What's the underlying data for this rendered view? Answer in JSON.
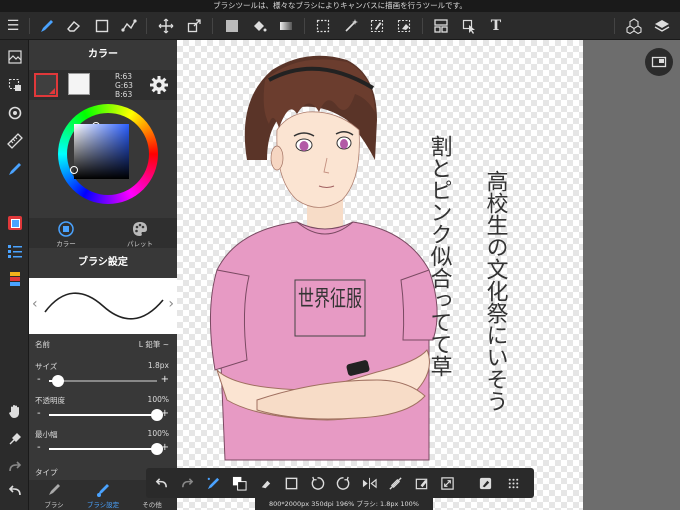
{
  "infobar": {
    "text": "ブラシツールは、様々なブラシによりキャンバスに描画を行うツールです。"
  },
  "color_panel": {
    "title": "カラー",
    "rgb": [
      "R:63",
      "G:63",
      "B:63"
    ],
    "tabs": [
      {
        "label": "カラー"
      },
      {
        "label": "パレット"
      }
    ]
  },
  "brush_panel": {
    "title": "ブラシ設定",
    "name_label": "名前",
    "name_value": "L 鉛筆 ~",
    "params": [
      {
        "label": "サイズ",
        "value": "1.8px",
        "level": 0.08
      },
      {
        "label": "不透明度",
        "value": "100%",
        "level": 1.0
      },
      {
        "label": "最小幅",
        "value": "100%",
        "level": 1.0
      }
    ],
    "type_label": "タイプ"
  },
  "bottom_tabs": [
    {
      "label": "ブラシ"
    },
    {
      "label": "ブラシ設定"
    },
    {
      "label": "その他"
    }
  ],
  "status": {
    "text": "800*2000px 350dpi 196% ブラシ: 1.8px 100%"
  },
  "canvas": {
    "shirt_text": "世界征服",
    "handwriting": [
      "割とピンク似合ってて草",
      "高校生の文化祭にいそう"
    ]
  },
  "colors": {
    "accent": "#4aa3ff",
    "selected_red": "#e0383a",
    "shirt_pink": "#e79ac4"
  }
}
